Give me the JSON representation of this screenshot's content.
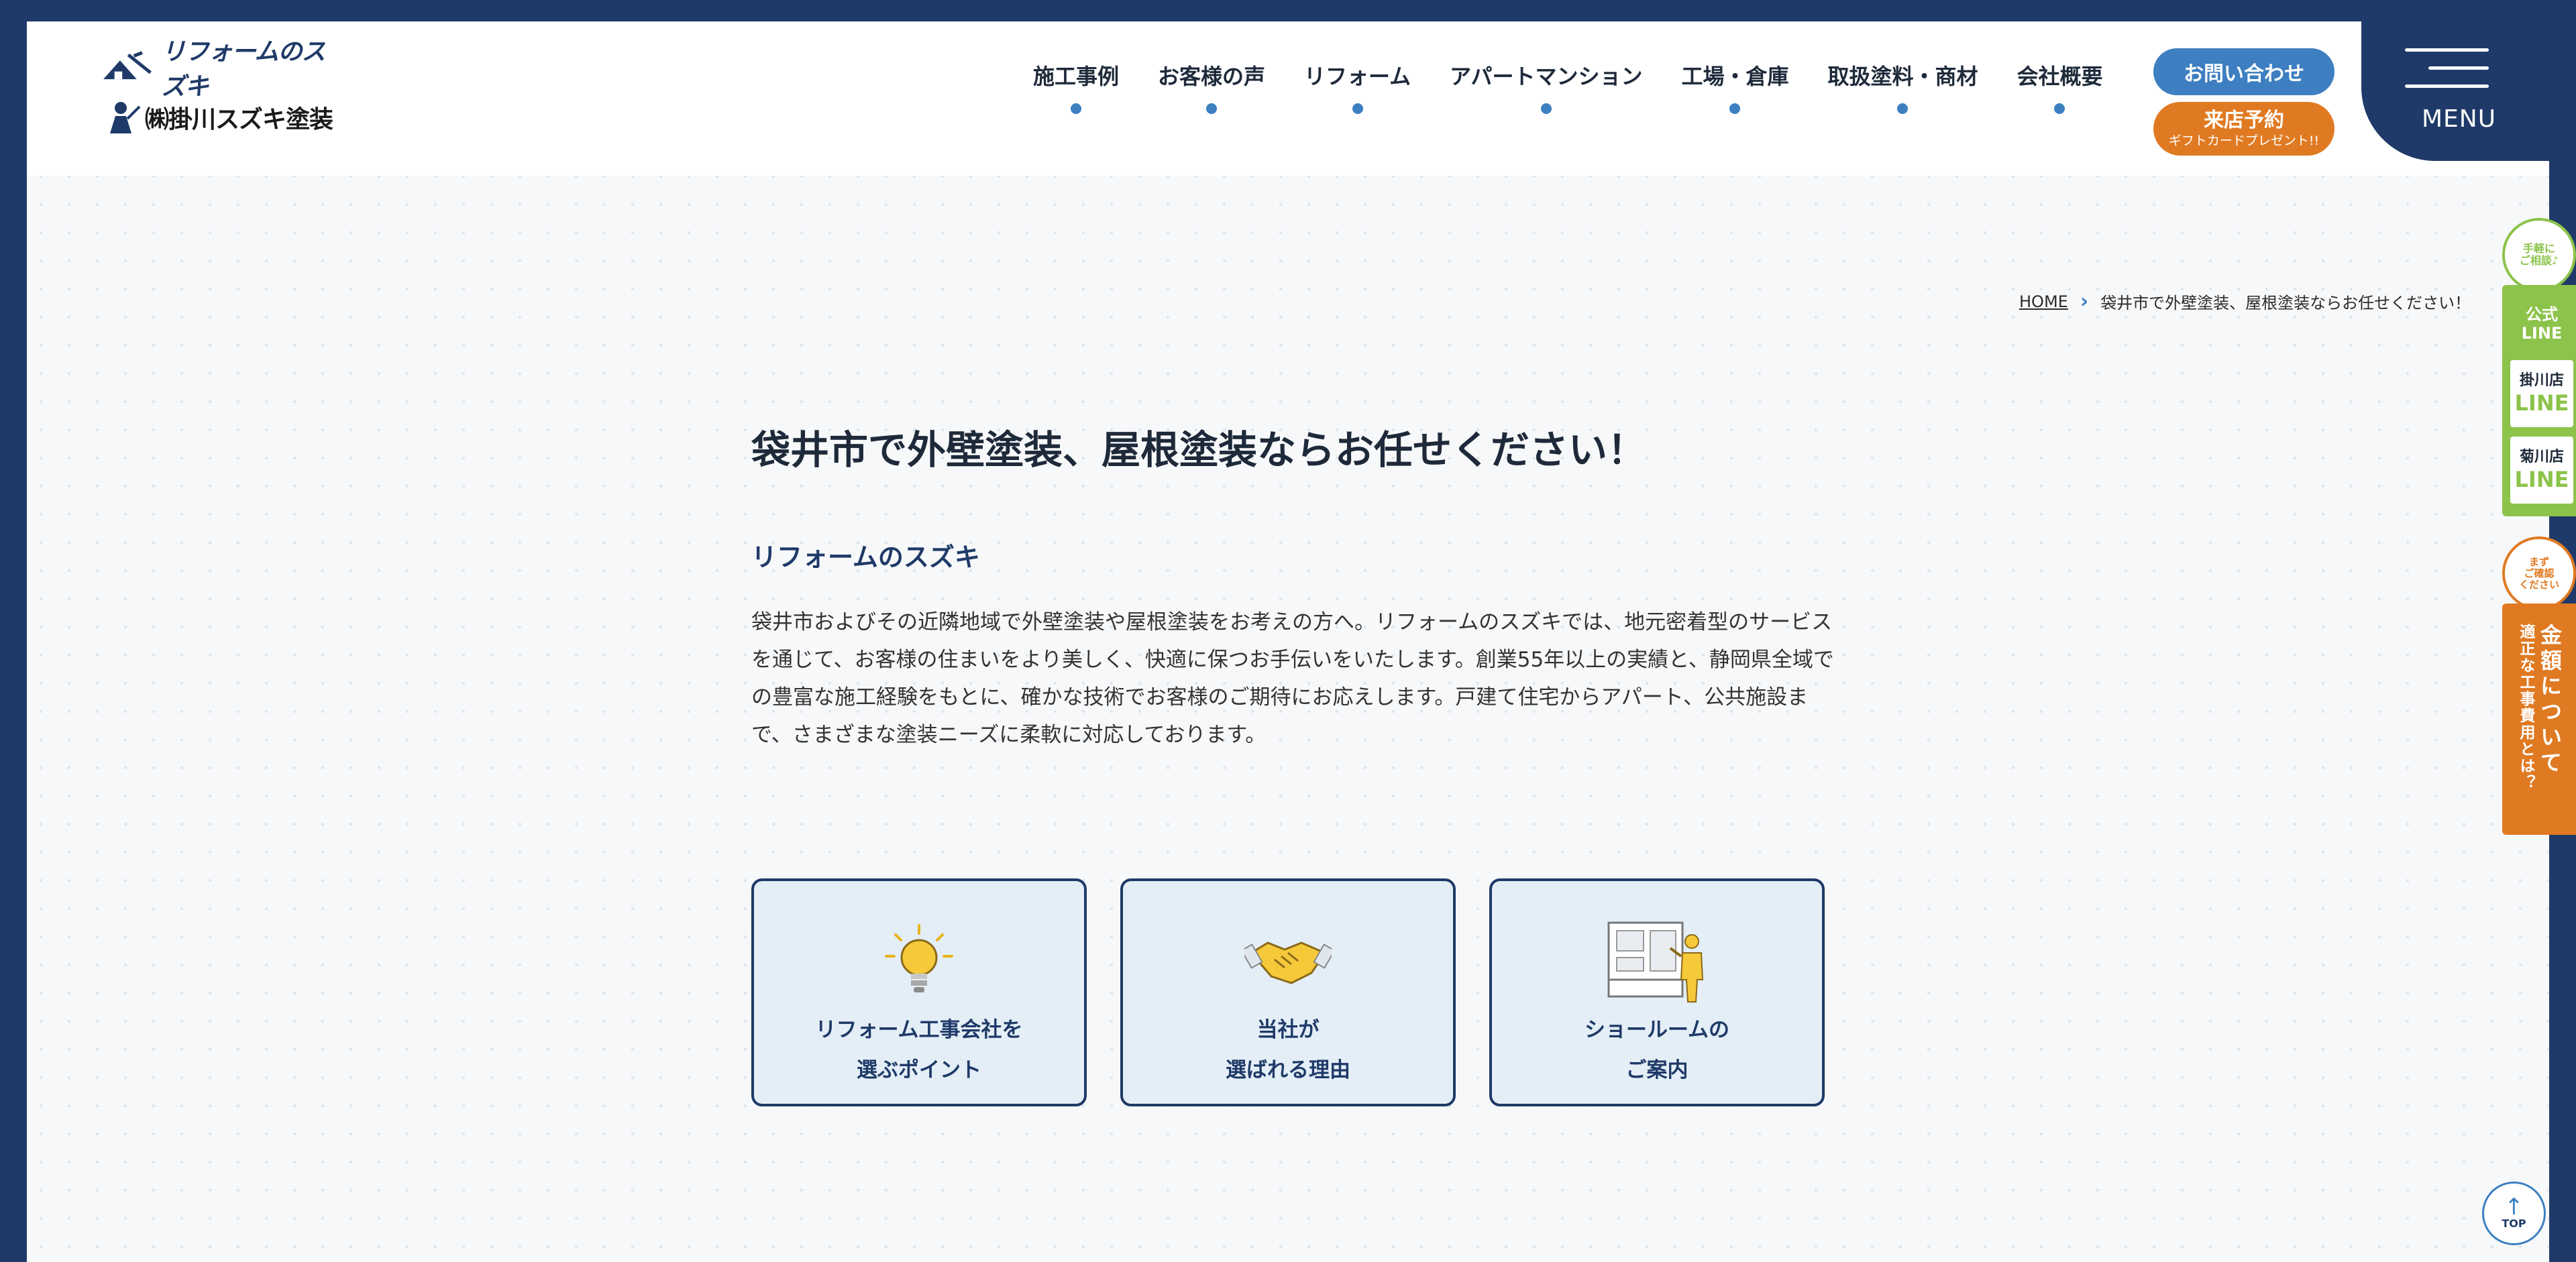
{
  "header": {
    "logo_line1": "リフォームのスズキ",
    "logo_line2": "㈱掛川スズキ塗装",
    "nav": [
      {
        "label": "施工事例"
      },
      {
        "label": "お客様の声"
      },
      {
        "label": "リフォーム"
      },
      {
        "label": "アパートマンション"
      },
      {
        "label": "工場・倉庫"
      },
      {
        "label": "取扱塗料・商材"
      },
      {
        "label": "会社概要"
      }
    ],
    "contact_label": "お問い合わせ",
    "visit_label": "来店予約",
    "visit_sub": "ギフトカードプレゼント!!",
    "menu_label": "MENU"
  },
  "breadcrumb": {
    "home": "HOME",
    "current": "袋井市で外壁塗装、屋根塗装ならお任せください！"
  },
  "main": {
    "title": "袋井市で外壁塗装、屋根塗装ならお任せください！",
    "subtitle": "リフォームのスズキ",
    "body": "袋井市およびその近隣地域で外壁塗装や屋根塗装をお考えの方へ。リフォームのスズキでは、地元密着型のサービスを通じて、お客様の住まいをより美しく、快適に保つお手伝いをいたします。創業55年以上の実績と、静岡県全域での豊富な施工経験をもとに、確かな技術でお客様のご期待にお応えします。戸建て住宅からアパート、公共施設まで、さまざまな塗装ニーズに柔軟に対応しております。",
    "cards": [
      {
        "label": "リフォーム工事会社を\n選ぶポイント",
        "icon": "lightbulb-icon"
      },
      {
        "label": "当社が\n選ばれる理由",
        "icon": "handshake-icon"
      },
      {
        "label": "ショールームの\nご案内",
        "icon": "showroom-icon"
      }
    ]
  },
  "side": {
    "line_bubble": "手軽に\nご相談♪",
    "line_title": "公式\nLINE",
    "stores": [
      {
        "store": "掛川店",
        "line": "LINE"
      },
      {
        "store": "菊川店",
        "line": "LINE"
      }
    ],
    "price_bubble": "まず\nご確認\nください",
    "price_main": "金額について",
    "price_sub": "適正な工事費用とは？"
  },
  "top_button": "TOP",
  "colors": {
    "navy": "#1f3a68",
    "blue": "#3d7fc1",
    "orange": "#e07a22",
    "green": "#8cc34a"
  }
}
